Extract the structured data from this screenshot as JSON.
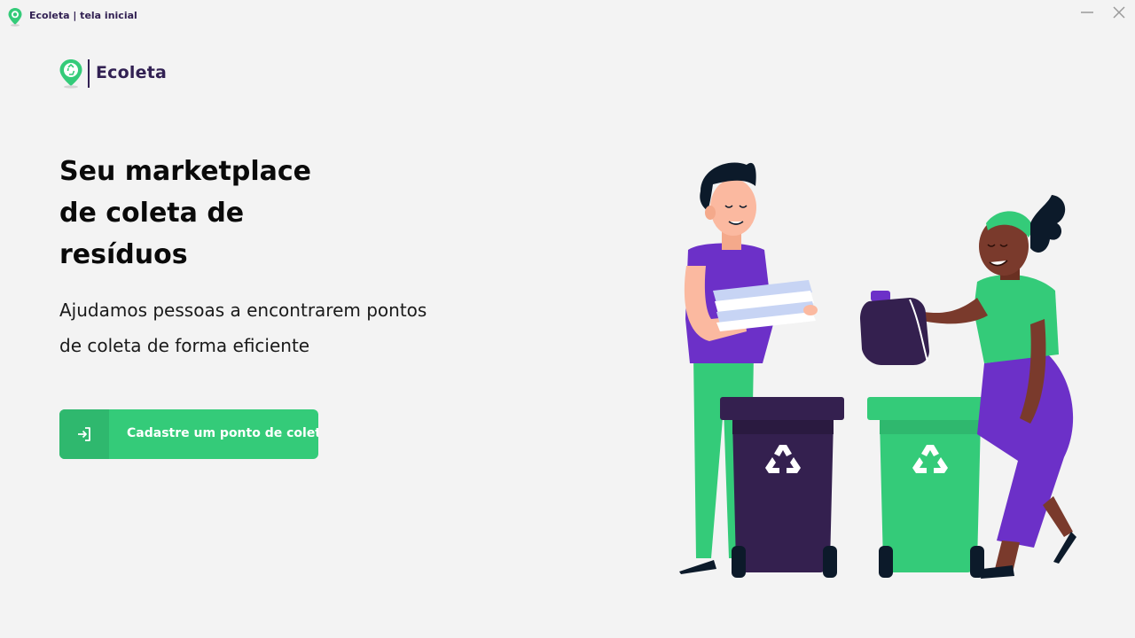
{
  "window": {
    "title": "Ecoleta | tela inicial",
    "minimize_icon": "minimize-icon",
    "close_icon": "close-icon"
  },
  "header": {
    "brand": "Ecoleta",
    "logo_icon": "recycle-pin-icon"
  },
  "hero": {
    "headline": [
      "Seu marketplace",
      "de coleta de",
      "resíduos"
    ],
    "subtitle": [
      "Ajudamos pessoas a encontrarem pontos",
      "de coleta de forma eficiente"
    ]
  },
  "cta": {
    "label": "Cadastre um ponto de coleta",
    "icon": "login-arrow-icon"
  },
  "colors": {
    "background": "#f3f3f3",
    "accent_green": "#34cb79",
    "accent_green_dark": "#2fb86e",
    "brand_purple": "#322153",
    "bin_purple": "#34204f",
    "shirt_purple": "#6c30c8"
  },
  "illustration": {
    "description_icon": "people-recycling-illustration"
  }
}
